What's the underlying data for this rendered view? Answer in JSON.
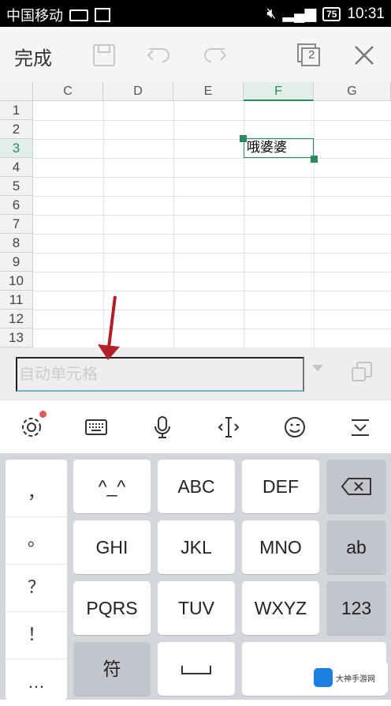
{
  "status_bar": {
    "carrier": "中国移动",
    "battery": "75",
    "time": "10:31"
  },
  "toolbar": {
    "done_label": "完成",
    "sheet_count": "2"
  },
  "sheet": {
    "columns": [
      "C",
      "D",
      "E",
      "F",
      "G"
    ],
    "active_column": "F",
    "rows": [
      "1",
      "2",
      "3",
      "4",
      "5",
      "6",
      "7",
      "8",
      "9",
      "10",
      "11",
      "12",
      "13"
    ],
    "active_row": "3",
    "active_cell_value": "哦婆婆"
  },
  "input_bar": {
    "placeholder": "自动单元格"
  },
  "keyboard": {
    "punctuation": [
      "，",
      "。",
      "？",
      "！",
      "…"
    ],
    "row1": [
      "^_^",
      "ABC",
      "DEF"
    ],
    "row2": [
      "GHI",
      "JKL",
      "MNO",
      "ab"
    ],
    "row3": [
      "PQRS",
      "TUV",
      "WXYZ",
      "123"
    ],
    "row4_symbols": "符"
  },
  "watermark": {
    "text": "大神手游网"
  },
  "colors": {
    "accent_green": "#2a8a5e",
    "input_underline": "#6fb6c9",
    "arrow_red": "#b3202a"
  }
}
